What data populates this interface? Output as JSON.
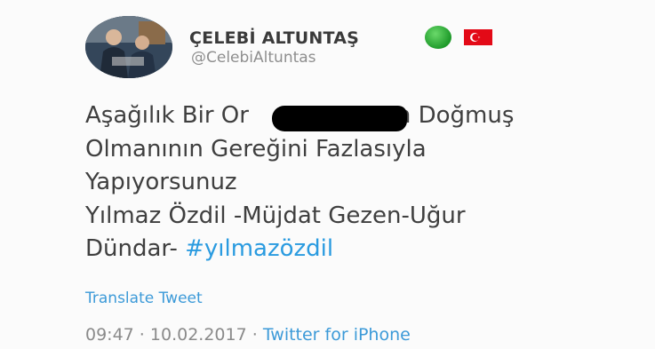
{
  "user": {
    "display_name": "ÇELEBİ ALTUNTAŞ",
    "handle": "@CelebiAltuntas",
    "avatar_icon": "profile-photo",
    "badge_green": "#1e9a2a",
    "flag": "turkey-flag-icon"
  },
  "tweet": {
    "lines": [
      "Aşağılık Bir Or",
      "an Doğmuş",
      "Olmanının Gereğini Fazlasıyla",
      "Yapıyorsunuz",
      "Yılmaz Özdil -Müjdat Gezen-Uğur",
      "Dündar- "
    ],
    "hashtag": "#yılmazözdil",
    "translate_label": "Translate Tweet",
    "time": "09:47",
    "separator": " · ",
    "date": "10.02.2017",
    "source": "Twitter for iPhone"
  },
  "colors": {
    "link": "#3c9ad8",
    "hashtag": "#2a9be0",
    "flag_red": "#e30a17"
  }
}
